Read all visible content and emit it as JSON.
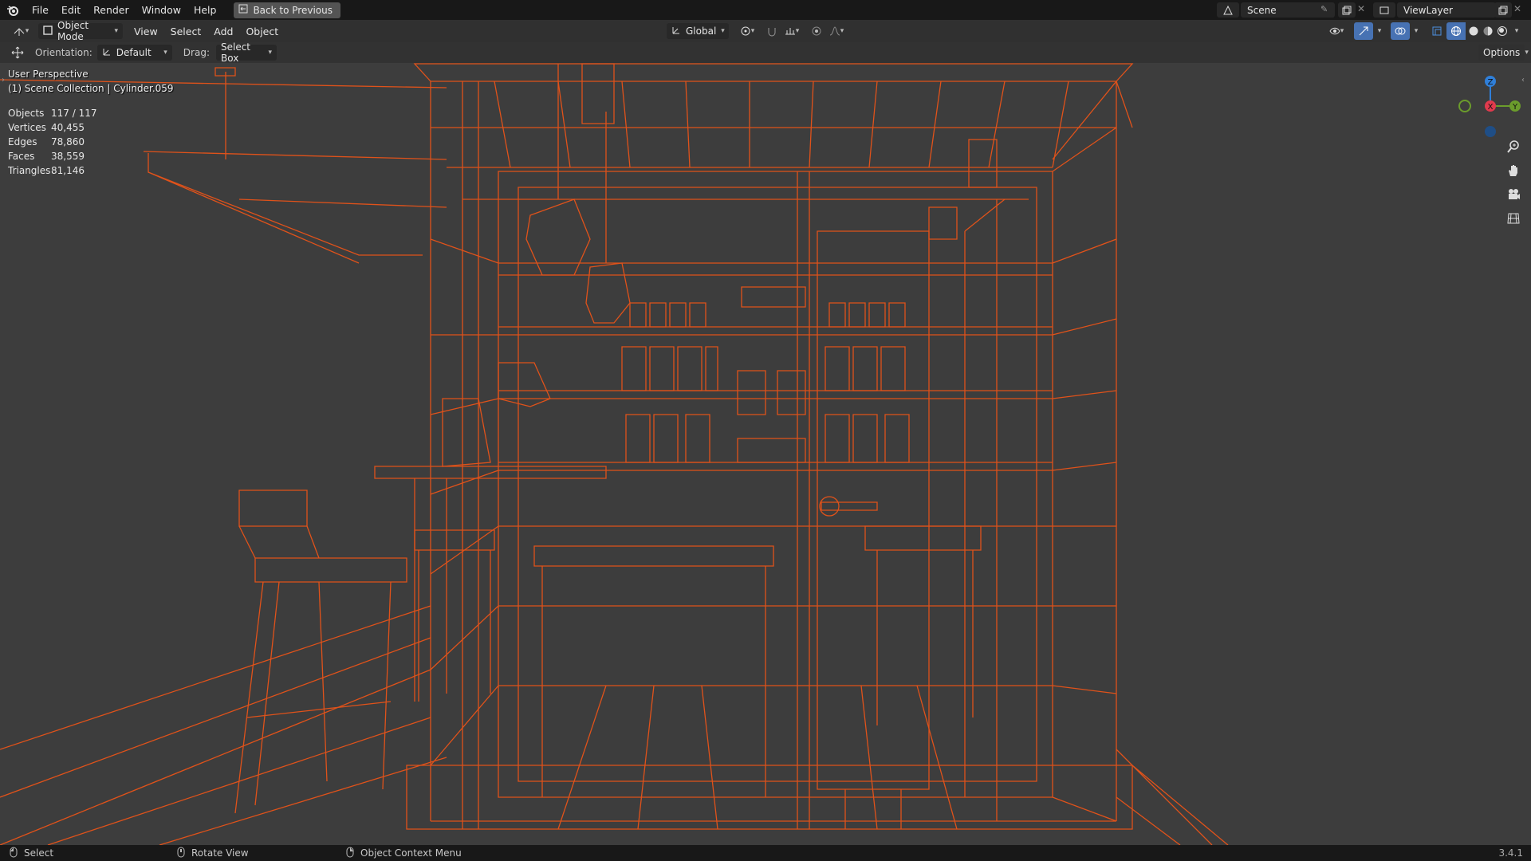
{
  "top_menu": {
    "items": [
      "File",
      "Edit",
      "Render",
      "Window",
      "Help"
    ],
    "back_label": "Back to Previous"
  },
  "scene": {
    "name": "Scene",
    "view_layer": "ViewLayer"
  },
  "header": {
    "mode": "Object Mode",
    "menus": [
      "View",
      "Select",
      "Add",
      "Object"
    ],
    "transform": "Global"
  },
  "tool_settings": {
    "orientation_label": "Orientation:",
    "orientation_value": "Default",
    "drag_label": "Drag:",
    "drag_value": "Select Box",
    "options_label": "Options"
  },
  "viewport": {
    "perspective": "User Perspective",
    "collection": "(1) Scene Collection | Cylinder.059",
    "wire_color": "#e0521a",
    "background": "#3d3d3d",
    "stats": [
      {
        "label": "Objects",
        "value": "117 / 117"
      },
      {
        "label": "Vertices",
        "value": "40,455"
      },
      {
        "label": "Edges",
        "value": "78,860"
      },
      {
        "label": "Faces",
        "value": "38,559"
      },
      {
        "label": "Triangles",
        "value": "81,146"
      }
    ],
    "gizmo": {
      "z": "Z",
      "x": "X",
      "y": "Y"
    }
  },
  "statusbar": {
    "select": "Select",
    "rotate": "Rotate View",
    "context": "Object Context Menu",
    "version": "3.4.1"
  }
}
